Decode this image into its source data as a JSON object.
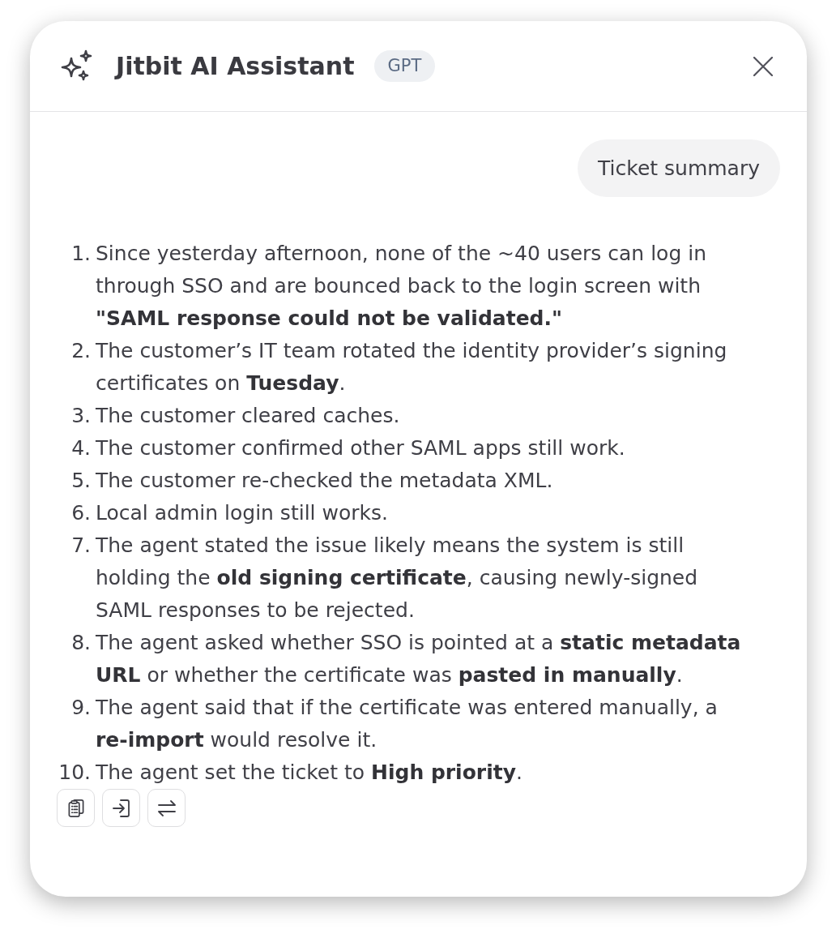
{
  "header": {
    "title": "Jitbit AI Assistant",
    "badge": "GPT"
  },
  "messages": [
    {
      "kind": "user",
      "text": "Ticket summary"
    },
    {
      "kind": "assistant",
      "items": [
        {
          "number": "1.",
          "text": "Since yesterday afternoon, none of the ~40 users can log in through SSO and are bounced back to the login screen with **\"SAML response could not be validated.\"**"
        },
        {
          "number": "2.",
          "text": "The customer’s IT team rotated the identity provider’s signing certificates on **Tuesday**."
        },
        {
          "number": "3.",
          "text": "The customer cleared caches."
        },
        {
          "number": "4.",
          "text": "The customer confirmed other SAML apps still work."
        },
        {
          "number": "5.",
          "text": "The customer re-checked the metadata XML."
        },
        {
          "number": "6.",
          "text": "Local admin login still works."
        },
        {
          "number": "7.",
          "text": "The agent stated the issue likely means the system is still holding the **old signing certificate**, causing newly-signed SAML responses to be rejected."
        },
        {
          "number": "8.",
          "text": "The agent asked whether SSO is pointed at a **static metadata URL** or whether the certificate was **pasted in manually**."
        },
        {
          "number": "9.",
          "text": "The agent said that if the certificate was entered manually, a **re-import** would resolve it."
        },
        {
          "number": "10.",
          "text": "The agent set the ticket to **High priority**."
        }
      ]
    }
  ]
}
